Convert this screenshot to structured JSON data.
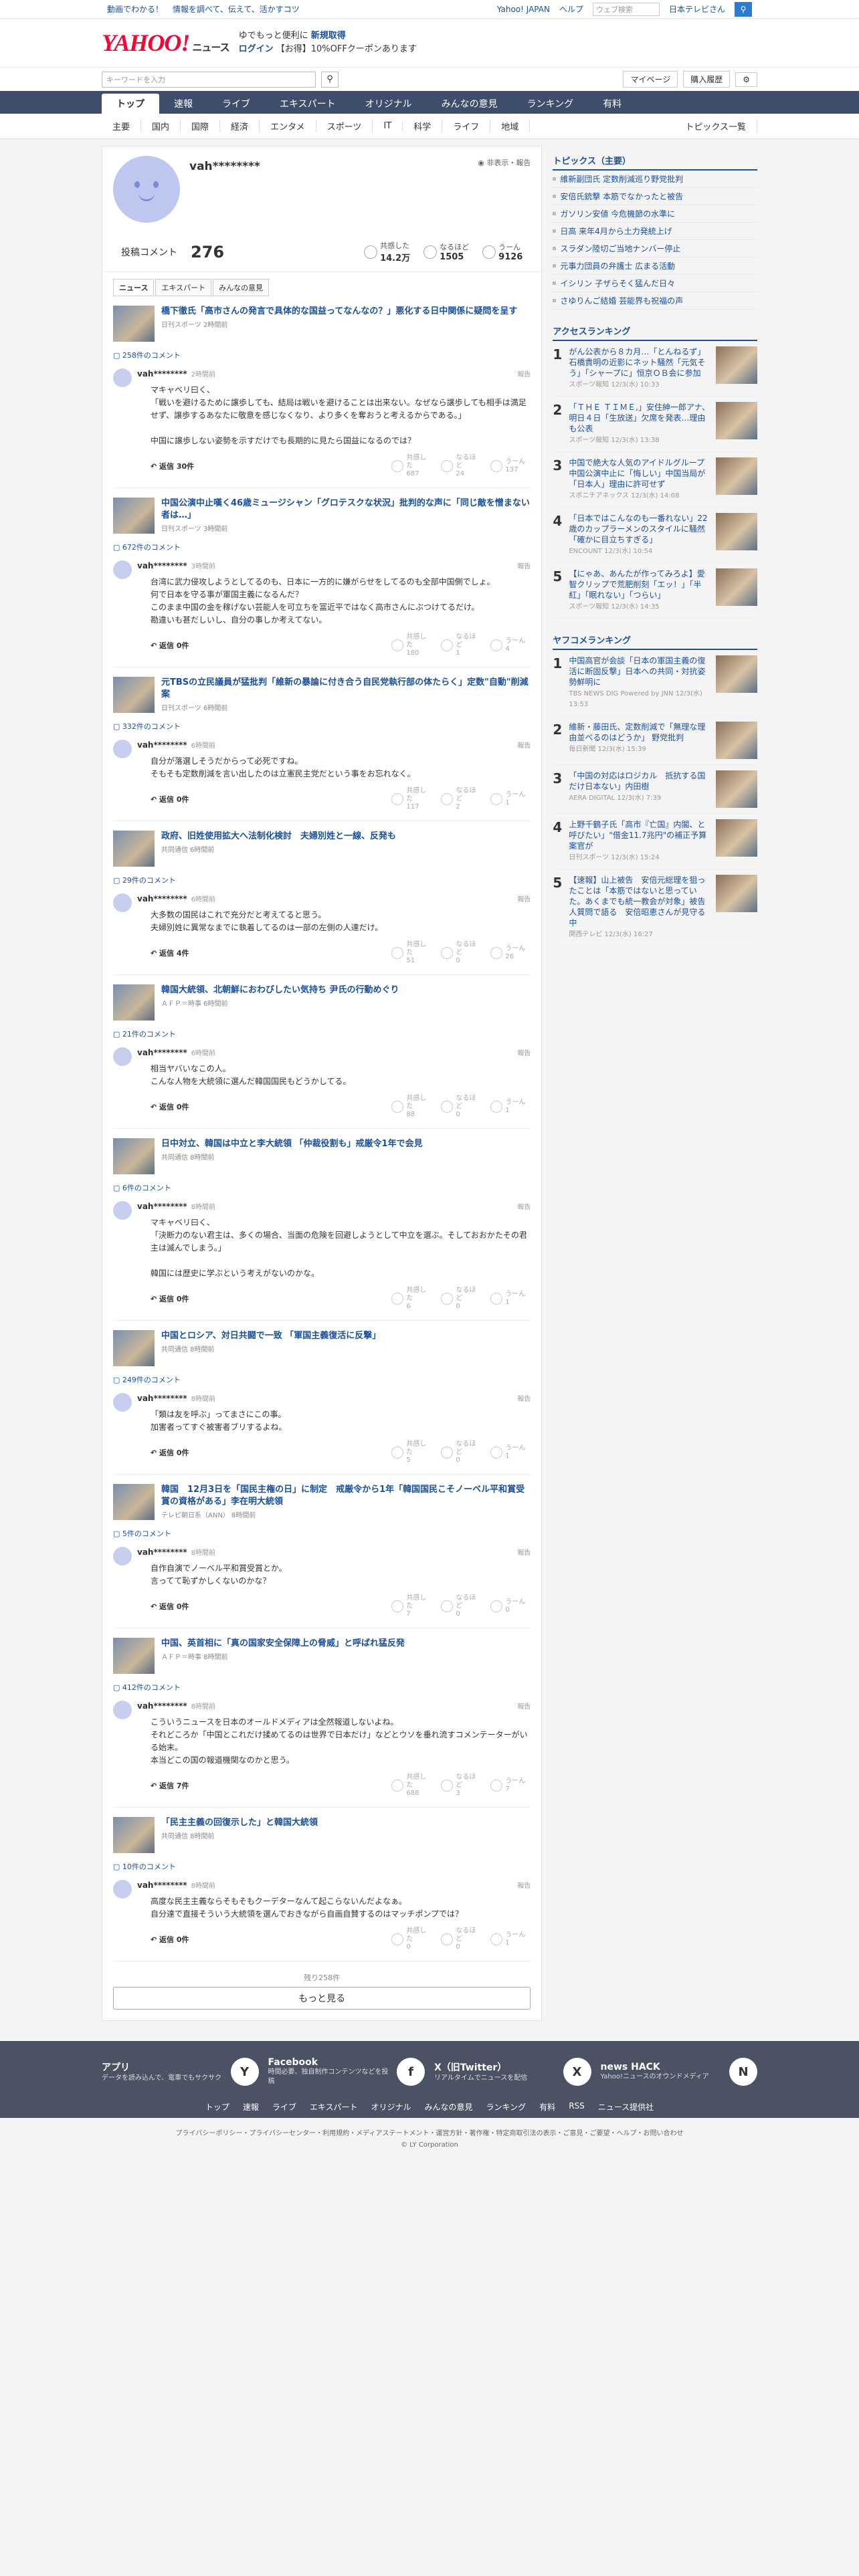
{
  "top": {
    "links": [
      "動画でわかる！",
      "情報を調べて、伝えて、活かすコツ"
    ],
    "right": [
      "Yahoo! JAPAN",
      "ヘルプ"
    ],
    "search_placeholder": "ウェブ検索",
    "site": "日本テレビさん"
  },
  "mast": {
    "logo": "YAHOO!",
    "logo_sub": "ニュース",
    "promo1": "ゆでもっと便利に",
    "promo1b": "新規取得",
    "promo2": "ログイン",
    "promo3": "【お得】10%OFFクーポンあります"
  },
  "sbar": {
    "placeholder": "キーワードを入力",
    "mypage": "マイページ",
    "buy": "購入履歴"
  },
  "nav1": [
    "トップ",
    "速報",
    "ライブ",
    "エキスパート",
    "オリジナル",
    "みんなの意見",
    "ランキング",
    "有料"
  ],
  "nav2": [
    "主要",
    "国内",
    "国際",
    "経済",
    "エンタメ",
    "スポーツ",
    "IT",
    "科学",
    "ライフ",
    "地域"
  ],
  "nav2_right": "トピックス一覧",
  "profile": {
    "name": "vah********",
    "privacy": "非表示・報告",
    "label": "投稿コメント",
    "count": "276",
    "s1l": "共感した",
    "s1": "14.2万",
    "s2l": "なるほど",
    "s2": "1505",
    "s3l": "うーん",
    "s3": "9126"
  },
  "tabs": [
    "ニュース",
    "エキスパート",
    "みんなの意見"
  ],
  "articles": [
    {
      "title": "橋下徹氏「高市さんの発言で具体的な国益ってなんなの？」悪化する日中関係に疑問を呈す",
      "meta": "日刊スポーツ 2時間前",
      "clink": "258件のコメント",
      "time": "2時間前",
      "text": "マキャベリ曰く、\n「戦いを避けるために譲歩しても、結局は戦いを避けることは出来ない。なぜなら譲歩しても相手は満足せず、譲歩するあなたに敬意を感じなくなり、より多くを奪おうと考えるからである。」\n\n中国に譲歩しない姿勢を示すだけでも長期的に見たら国益になるのでは？",
      "rep": "返信 30件",
      "r": [
        "687",
        "24",
        "137"
      ]
    },
    {
      "title": "中国公演中止嘆く46歳ミュージシャン「グロテスクな状況」批判的な声に「同じ敵を憎まない者は…」",
      "meta": "日刊スポーツ 3時間前",
      "clink": "672件のコメント",
      "time": "3時間前",
      "text": "台湾に武力侵攻しようとしてるのも、日本に一方的に嫌がらせをしてるのも全部中国側でしょ。\n何で日本を守る事が軍国主義になるんだ？\nこのまま中国の金を稼げない芸能人を可立ちを冨近平ではなく高市さんにぶつけてるだけ。\n勘違いも甚だしいし、自分の事しか考えてない。",
      "rep": "返信 0件",
      "r": [
        "180",
        "1",
        "4"
      ]
    },
    {
      "title": "元TBSの立民議員が猛批判「維新の暴論に付き合う自民党執行部の体たらく」定数\"自動\"削減案",
      "meta": "日刊スポーツ 6時間前",
      "clink": "332件のコメント",
      "time": "6時間前",
      "text": "自分が落選しそうだからって必死ですね。\nそもそも定数削減を言い出したのは立憲民主党だという事をお忘れなく。",
      "rep": "返信 0件",
      "r": [
        "117",
        "2",
        "1"
      ]
    },
    {
      "title": "政府、旧姓使用拡大へ法制化検討　夫婦別姓と一線、反発も",
      "meta": "共同通信 6時間前",
      "clink": "29件のコメント",
      "time": "6時間前",
      "text": "大多数の国民はこれで充分だと考えてると思う。\n夫婦別姓に異常なまでに執着してるのは一部の左側の人達だけ。",
      "rep": "返信 4件",
      "r": [
        "51",
        "0",
        "26"
      ]
    },
    {
      "title": "韓国大統領、北朝鮮におわびしたい気持ち 尹氏の行動めぐり",
      "meta": "ＡＦＰ＝時事 6時間前",
      "clink": "21件のコメント",
      "time": "6時間前",
      "text": "相当ヤバいなこの人。\nこんな人物を大統領に選んだ韓国国民もどうかしてる。",
      "rep": "返信 0件",
      "r": [
        "88",
        "0",
        "1"
      ]
    },
    {
      "title": "日中対立、韓国は中立と李大統領 「仲裁役割も」戒厳令1年で会見",
      "meta": "共同通信 8時間前",
      "clink": "6件のコメント",
      "time": "8時間前",
      "text": "マキャベリ曰く、\n「決断力のない君主は、多くの場合、当面の危険を回避しようとして中立を選ぶ。そしておおかたその君主は滅んでしまう。」\n\n韓国には歴史に学ぶという考えがないのかな。",
      "rep": "返信 0件",
      "r": [
        "6",
        "0",
        "1"
      ]
    },
    {
      "title": "中国とロシア、対日共闘で一致 「軍国主義復活に反撃」",
      "meta": "共同通信 8時間前",
      "clink": "249件のコメント",
      "time": "8時間前",
      "text": "「類は友を呼ぶ」ってまさにこの事。\n加害者ってすぐ被害者ブリするよね。",
      "rep": "返信 0件",
      "r": [
        "5",
        "0",
        "1"
      ]
    },
    {
      "title": "韓国　12月3日を「国民主権の日」に制定　戒厳令から1年「韓国国民こそノーベル平和賞受賞の資格がある」李在明大統領",
      "meta": "テレビ朝日系（ANN） 8時間前",
      "clink": "5件のコメント",
      "time": "8時間前",
      "text": "自作自演でノーベル平和賞受賞とか。\n言ってて恥ずかしくないのかな？",
      "rep": "返信 0件",
      "r": [
        "7",
        "0",
        "0"
      ]
    },
    {
      "title": "中国、英首相に「真の国家安全保障上の脅威」と呼ばれ猛反発",
      "meta": "ＡＦＰ＝時事 8時間前",
      "clink": "412件のコメント",
      "time": "8時間前",
      "text": "こういうニュースを日本のオールドメディアは全然報道しないよね。\nそれどころか「中国とこれだけ揉めてるのは世界で日本だけ」などとウソを垂れ流すコメンテーターがいる始末。\n本当どこの国の報道機関なのかと思う。",
      "rep": "返信 7件",
      "r": [
        "688",
        "3",
        "7"
      ]
    },
    {
      "title": "「民主主義の回復示した」と韓国大統領",
      "meta": "共同通信 8時間前",
      "clink": "10件のコメント",
      "time": "8時間前",
      "text": "高度な民主主義ならそもそもクーデターなんて起こらないんだよなぁ。\n自分達で直接そういう大統領を選んでおきながら自画自賛するのはマッチポンプでは？",
      "rep": "返信 0件",
      "r": [
        "0",
        "0",
        "1"
      ]
    }
  ],
  "react_labels": [
    "共感した",
    "なるほど",
    "うーん"
  ],
  "report": "報告",
  "more": {
    "remaining": "残り258件",
    "button": "もっと見る"
  },
  "side": {
    "topics_title": "トピックス（主要）",
    "topics": [
      "維新副団氏 定数削減巡り野党批判",
      "安倍氏銃撃 本筋でなかったと被告",
      "ガソリン安値 今危機節の水準に",
      "日高 来年4月から土力発統上げ",
      "スラダン陸切ご当地ナンバー停止",
      "元事力団員の弁護士 広まる活動",
      "イシリン 子ザらそく猛んだ日々",
      "さゆりんご結婚 芸能界も祝福の声"
    ],
    "rank_title": "アクセスランキング",
    "ranks": [
      {
        "t": "がん公表から８カ月…「とんねるず」石橋貴明の近影にネット騒然「元気そう」「シャープに」恒京ＯＢ会に参加",
        "s": "スポーツ報知 12/3(水) 10:33"
      },
      {
        "t": "「ＴＨＥ ＴＩＭＥ,」安住紳一郎アナ、明日４日「生放送」欠席を発表…理由も公表",
        "s": "スポーツ報知 12/3(水) 13:38"
      },
      {
        "t": "中国で絶大な人気のアイドルグループ　中国公演中止に「悔しい」中国当局が「日本人」理由に許可せず",
        "s": "スポニチアネックス 12/3(水) 14:08"
      },
      {
        "t": "「日本ではこんなのも一番れない」22歳のカップラーメンのスタイルに騒然「確かに目立ちすぎる」",
        "s": "ENCOUNT 12/3(水) 10:54"
      },
      {
        "t": "【にゃあ、あんたが作ってみろよ】愛智クリップで荒肥削刻「エッ！」「半紅」「眠れない」「つらい」",
        "s": "スポーツ報知 12/3(水) 14:35"
      }
    ],
    "cmt_title": "ヤフコメランキング",
    "cranks": [
      {
        "t": "中国高官が会談「日本の軍国主義の復活に断固反撃」日本への共同・対抗姿勢鮮明に",
        "s": "TBS NEWS DIG Powered by JNN 12/3(水) 13:53"
      },
      {
        "t": "維新・藤田氏、定数削減で「無理な理由並べるのはどうか」 野党批判",
        "s": "毎日新聞 12/3(水) 15:39"
      },
      {
        "t": "「中国の対応はロジカル　抵抗する国だけ日本ない」内田樹",
        "s": "AERA DIGITAL 12/3(水) 7:39"
      },
      {
        "t": "上野千鶴子氏「高市『亡国』内閣、と呼びたい」\"借金11.7兆円\"の補正予算案官が",
        "s": "日刊スポーツ 12/3(水) 15:24"
      },
      {
        "t": "【速報】山上被告　安倍元総理を狙ったことは「本筋ではないと思っていた。あくまでも統一教会が対象」被告人質問で語る　安倍昭恵さんが見守る中",
        "s": "関西テレビ 12/3(水) 16:27"
      }
    ]
  },
  "footer": {
    "cards": [
      {
        "t": "アプリ",
        "d": "データを読み込んで、電車でもサクサク",
        "i": "Y"
      },
      {
        "t": "Facebook",
        "d": "時間必要、独自制作コンテンツなどを投稿",
        "i": "f"
      },
      {
        "t": "X（旧Twitter）",
        "d": "リアルタイムでニュースを配信",
        "i": "X"
      },
      {
        "t": "news HACK",
        "d": "Yahoo!ニュースのオウンドメディア",
        "i": "N"
      }
    ],
    "links": [
      "トップ",
      "速報",
      "ライブ",
      "エキスパート",
      "オリジナル",
      "みんなの意見",
      "ランキング",
      "有料",
      "RSS",
      "ニュース提供社"
    ],
    "legal": "プライバシーポリシー・プライバシーセンター・利用規約・メディアステートメント・運営方針・著作権・特定商取引法の表示・ご意見・ご要望・ヘルプ・お問い合わせ",
    "copy": "© LY Corporation"
  }
}
